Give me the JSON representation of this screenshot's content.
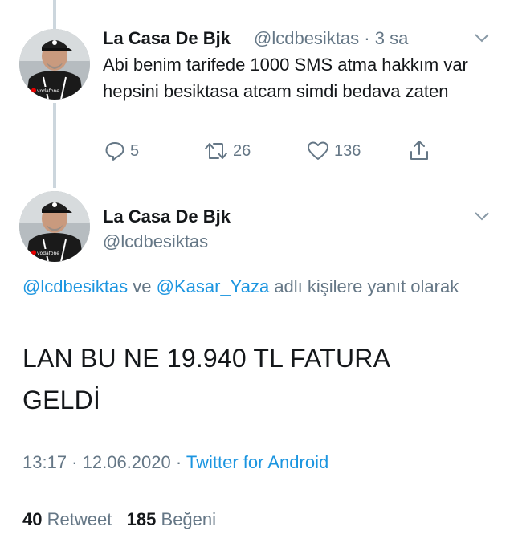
{
  "tweet1": {
    "author_name": "La Casa De Bjk",
    "author_handle": "@lcdbesiktas",
    "separator": "·",
    "time_ago": "3 sa",
    "text": "Abi benim tarifede 1000 SMS atma hakkım var hepsini besiktasa atcam simdi bedava zaten",
    "reply_count": "5",
    "retweet_count": "26",
    "like_count": "136",
    "avatar_badge": "vodafone"
  },
  "tweet2": {
    "author_name": "La Casa De Bjk",
    "author_handle": "@lcdbesiktas",
    "reply_mention_1": "@lcdbesiktas",
    "reply_joiner": " ve ",
    "reply_mention_2": "@Kasar_Yaza",
    "reply_suffix": " adlı kişilere yanıt olarak",
    "text": "LAN BU NE 19.940 TL FATURA GELDİ",
    "time": "13:17",
    "date_separator": " · ",
    "date": "12.06.2020",
    "source_separator": " · ",
    "source": "Twitter for Android",
    "retweet_count": "40",
    "retweet_label": "Retweet",
    "like_count": "185",
    "like_label": "Beğeni",
    "avatar_badge": "vodafone"
  },
  "colors": {
    "link": "#1b95e0",
    "secondary_text": "#657786",
    "primary_text": "#14171a",
    "thread_line": "#ccd6dd"
  },
  "icons": {
    "reply": "reply-icon",
    "retweet": "retweet-icon",
    "like": "heart-icon",
    "share": "share-icon",
    "more": "chevron-down-icon"
  }
}
